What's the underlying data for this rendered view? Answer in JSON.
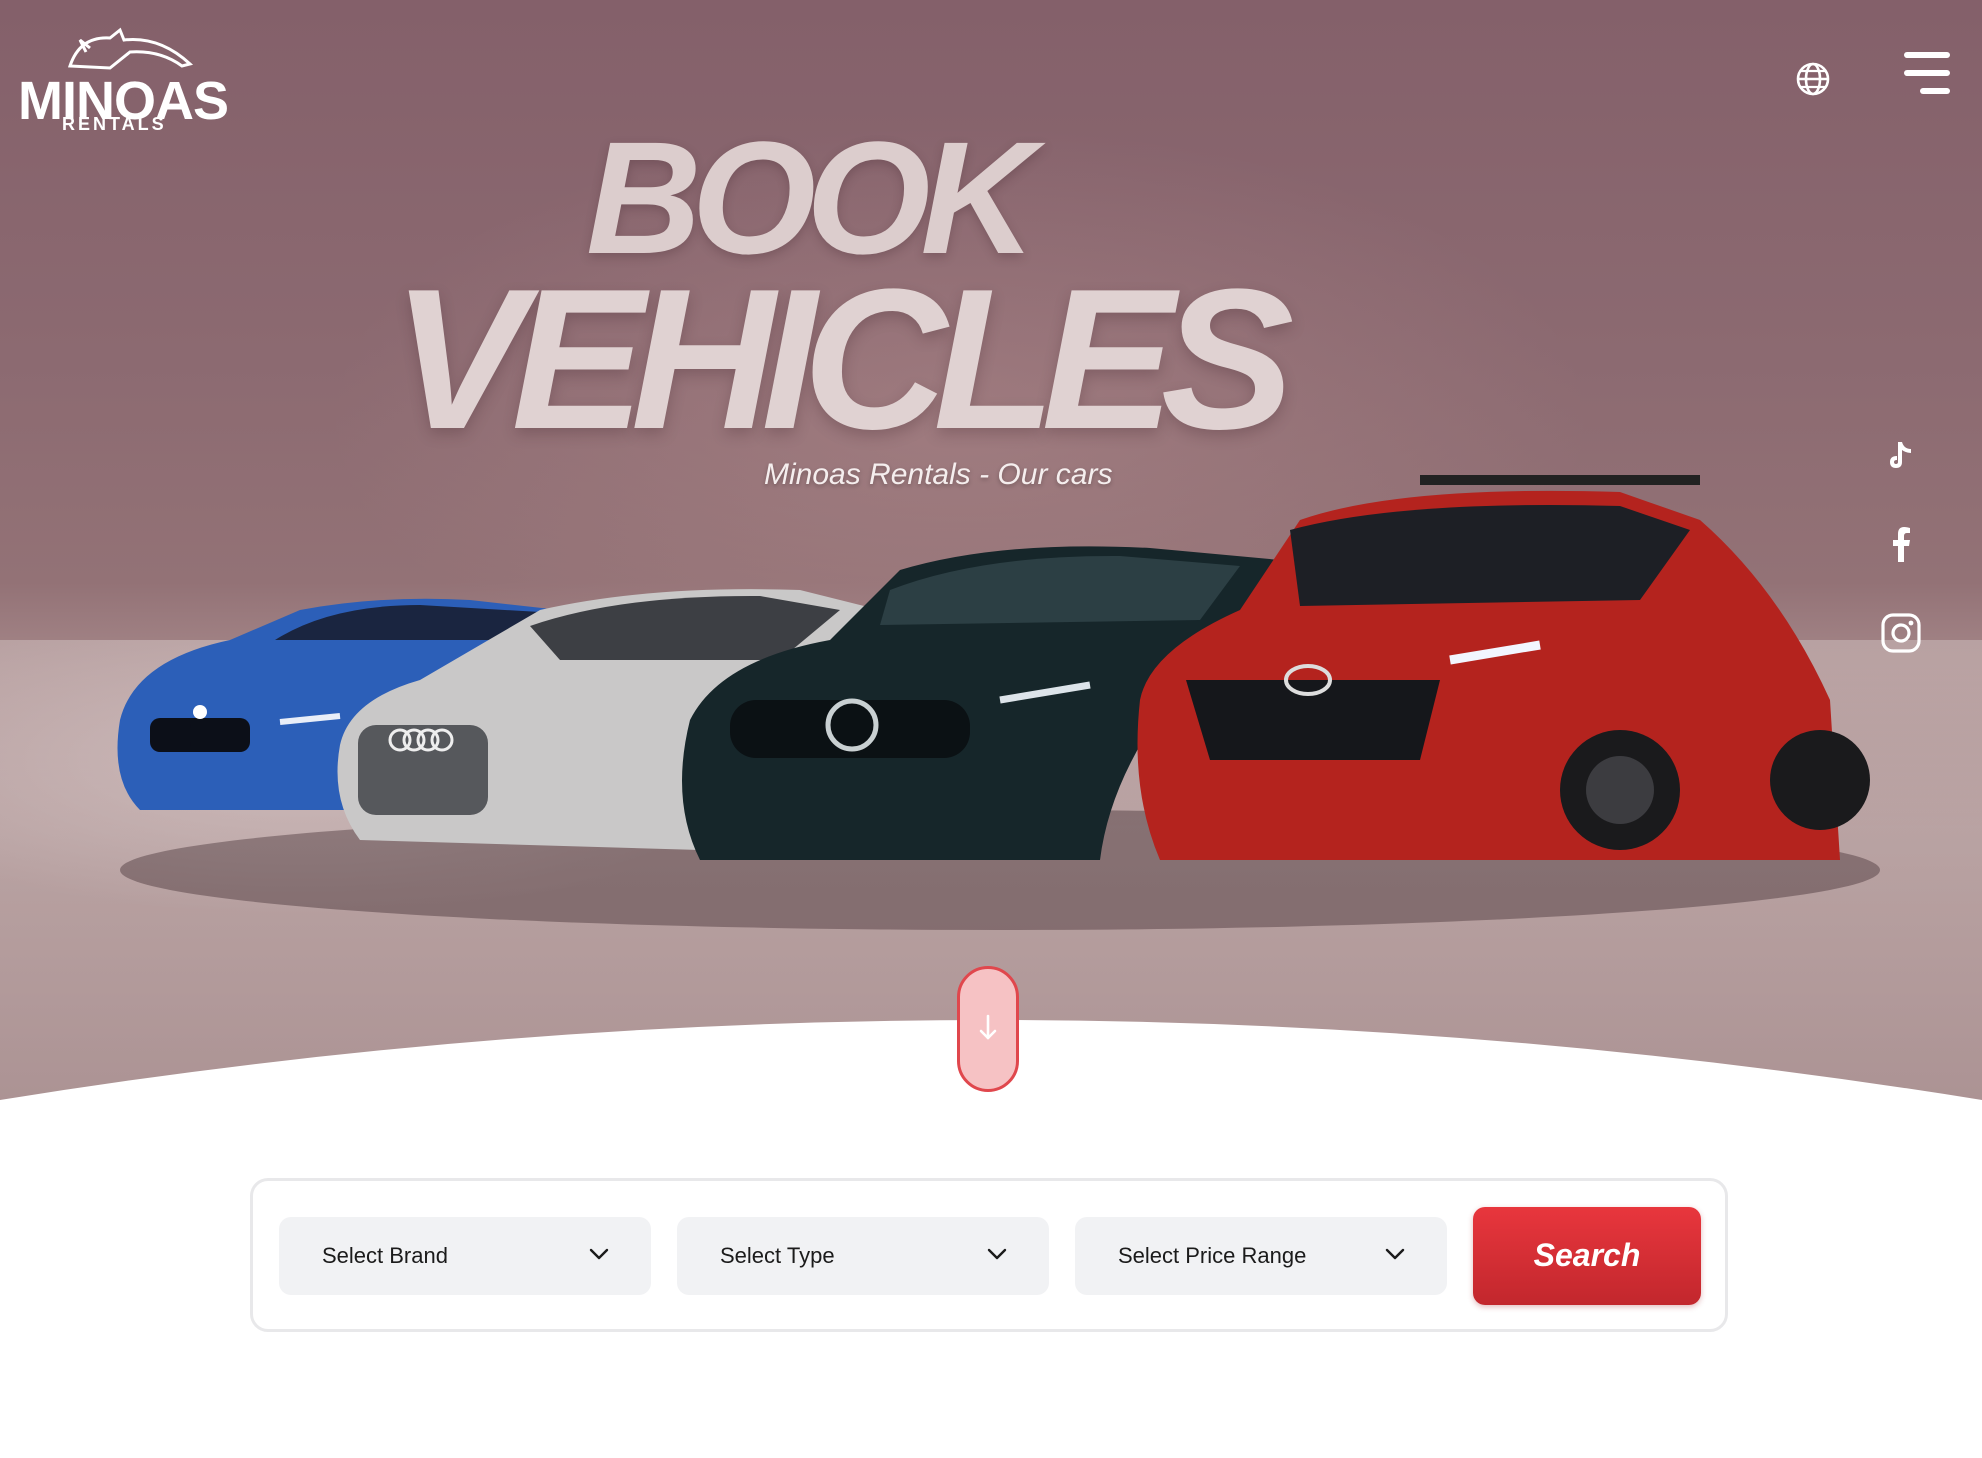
{
  "brand": {
    "name": "MINOAS",
    "subtitle": "RENTALS"
  },
  "header": {
    "language_icon": "globe-icon",
    "menu_icon": "hamburger-menu-icon"
  },
  "hero": {
    "headline_line1": "BOOK",
    "headline_line2": "VEHICLES",
    "tagline": "Minoas Rentals - Our cars"
  },
  "social": [
    {
      "name": "tiktok",
      "icon": "tiktok-icon"
    },
    {
      "name": "facebook",
      "icon": "facebook-icon"
    },
    {
      "name": "instagram",
      "icon": "instagram-icon"
    }
  ],
  "scroll_button": {
    "icon": "arrow-down-icon"
  },
  "search": {
    "brand_select": {
      "label": "Select Brand"
    },
    "type_select": {
      "label": "Select Type"
    },
    "price_select": {
      "label": "Select Price Range"
    },
    "submit_label": "Search"
  },
  "colors": {
    "accent": "#d42e35",
    "hero_background": "#8c6a71",
    "select_background": "#f1f2f4"
  }
}
